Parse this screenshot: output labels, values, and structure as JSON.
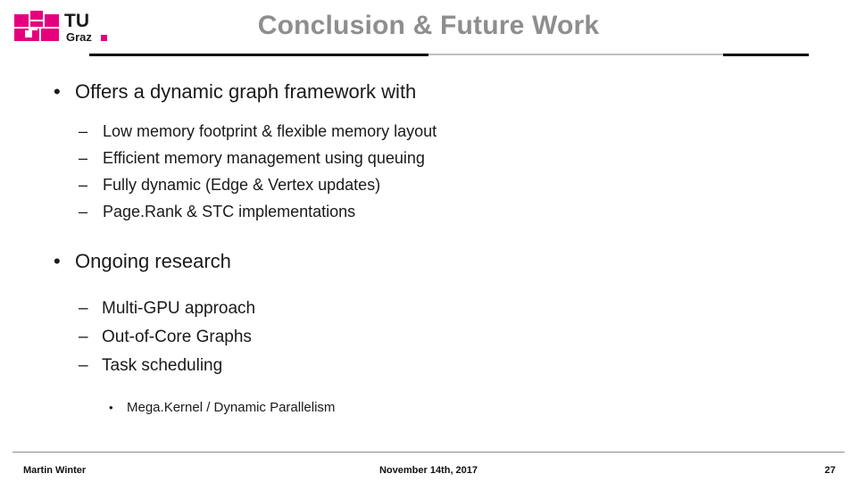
{
  "logo": {
    "name": "tu-graz-logo",
    "wordmark": "TU",
    "subtext": "Graz",
    "color": "#e6007e"
  },
  "header": {
    "title": "Conclusion & Future Work",
    "title_color": "#8e8e8e"
  },
  "content": {
    "sections": [
      {
        "heading": "Offers a dynamic graph framework with",
        "bullet": "•",
        "items": [
          {
            "dash": "–",
            "text": "Low memory footprint & flexible memory layout"
          },
          {
            "dash": "–",
            "text": "Efficient memory management using queuing"
          },
          {
            "dash": "–",
            "text": "Fully dynamic (Edge & Vertex updates)"
          },
          {
            "dash": "–",
            "text": "Page.Rank & STC implementations"
          }
        ]
      },
      {
        "heading": "Ongoing research",
        "bullet": "•",
        "items": [
          {
            "dash": "–",
            "text": "Multi-GPU approach"
          },
          {
            "dash": "–",
            "text": "Out-of-Core Graphs"
          },
          {
            "dash": "–",
            "text": "Task scheduling"
          }
        ],
        "subitems": [
          {
            "bullet": "•",
            "text": "Mega.Kernel / Dynamic Parallelism"
          }
        ]
      }
    ]
  },
  "footer": {
    "author": "Martin Winter",
    "date": "November 14th, 2017",
    "page_number": "27"
  }
}
